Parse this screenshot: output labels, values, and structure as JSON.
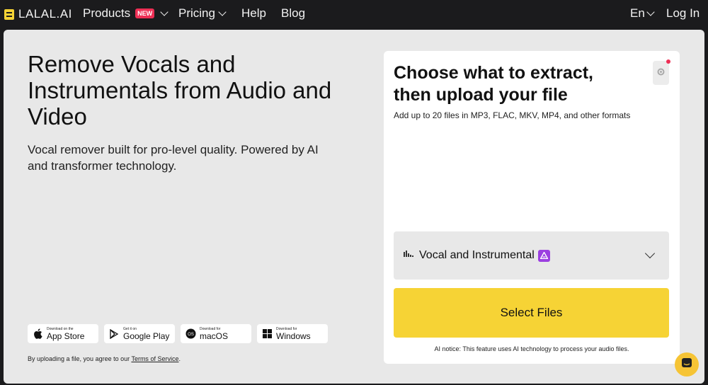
{
  "header": {
    "logo_text": "LALAL.AI",
    "nav": {
      "products": "Products",
      "products_badge": "NEW",
      "pricing": "Pricing",
      "help": "Help",
      "blog": "Blog",
      "language": "En",
      "login": "Log In"
    }
  },
  "hero": {
    "title": "Remove Vocals and Instrumentals from Audio and Video",
    "subtitle": "Vocal remover built for pro-level quality. Powered by AI and transformer technology."
  },
  "stores": [
    {
      "small": "Download on the",
      "big": "App Store",
      "icon": "apple-icon"
    },
    {
      "small": "Get it on",
      "big": "Google Play",
      "icon": "google-play-icon"
    },
    {
      "small": "Download for",
      "big": "macOS",
      "icon": "macos-icon"
    },
    {
      "small": "Download for",
      "big": "Windows",
      "icon": "windows-icon"
    }
  ],
  "tos": {
    "prefix": "By uploading a file, you agree to our ",
    "link": "Terms of Service",
    "suffix": "."
  },
  "upload": {
    "title": "Choose what to extract, then upload your file",
    "subtitle": "Add up to 20 files in MP3, FLAC, MKV, MP4, and other formats",
    "stem_selected": "Vocal and Instrumental",
    "select_button": "Select Files",
    "ai_notice": "AI notice: This feature uses AI technology to process your audio files."
  },
  "colors": {
    "accent": "#f6d335",
    "background": "#1b1b1d",
    "card": "#e8e8e8",
    "badge": "#ee2f55",
    "ai_badge": "#9b3fe0"
  }
}
